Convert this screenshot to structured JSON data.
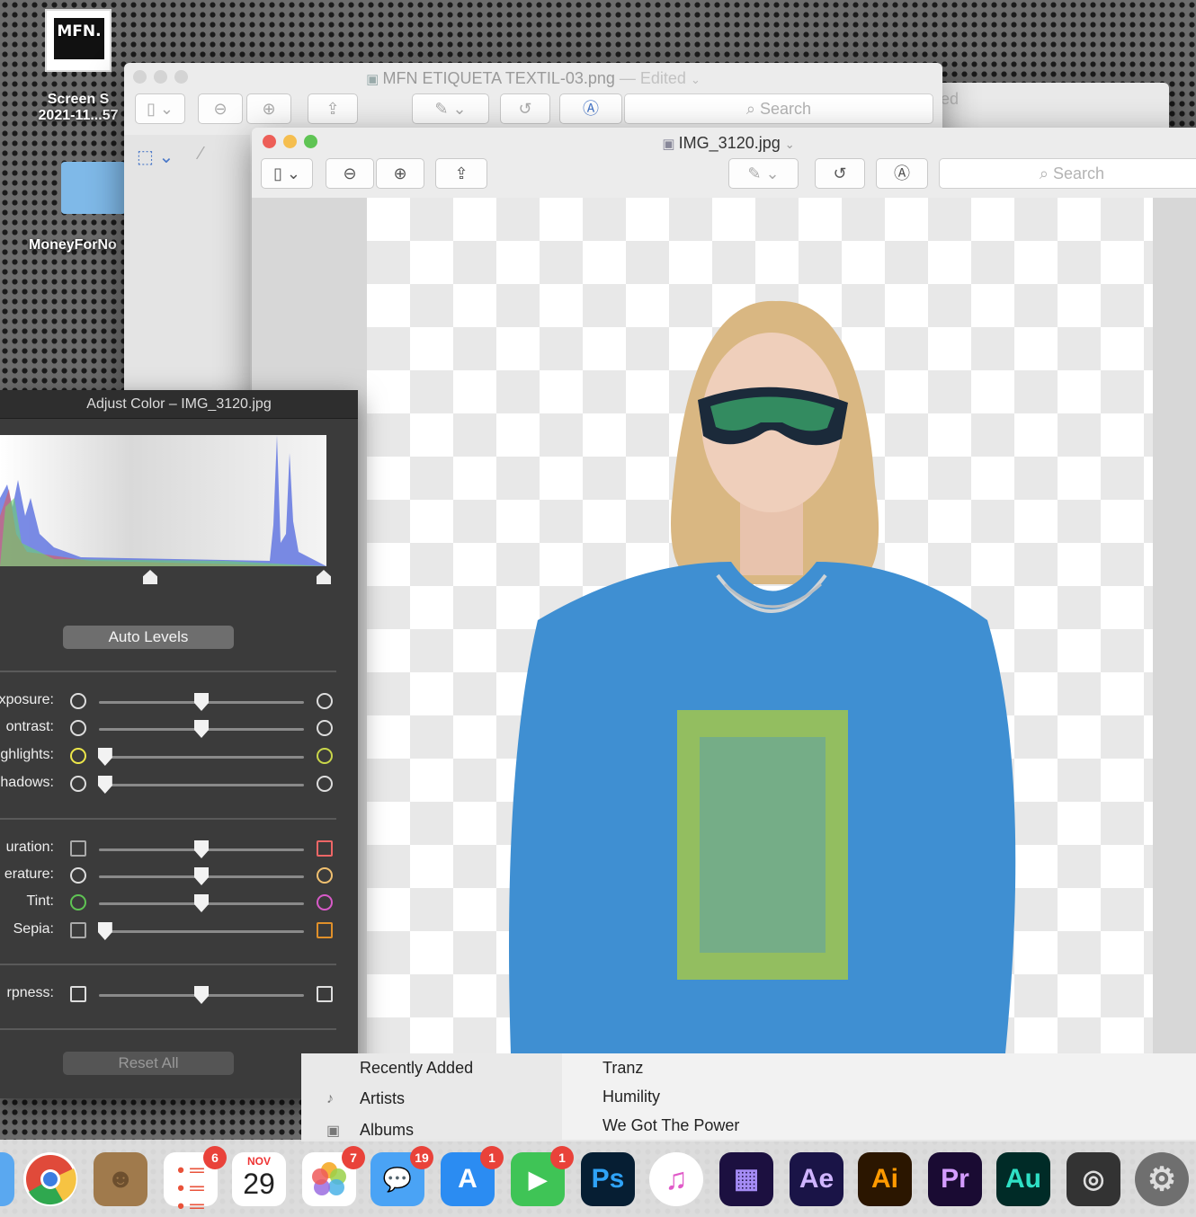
{
  "desktop": {
    "icon1_label": "Screen Sh\n2021-11...57",
    "icon1_label_a": "Screen S",
    "icon1_label_b": "2021-11...57",
    "thumb_text": "MFN.",
    "folder_label": "MoneyForNo"
  },
  "back_window": {
    "title": "MFN ETIQUETA TEXTIL-03.png",
    "edited": "— Edited",
    "search_placeholder": "Search",
    "side_title": "ed"
  },
  "front_window": {
    "title": "IMG_3120.jpg",
    "search_placeholder": "Search"
  },
  "adjust_panel": {
    "title": "Adjust Color – IMG_3120.jpg",
    "auto_levels": "Auto Levels",
    "reset_all": "Reset All",
    "rows": [
      {
        "label": "xposure:",
        "value": 0.5
      },
      {
        "label": "ontrast:",
        "value": 0.5
      },
      {
        "label": "ghlights:",
        "value": 0.03
      },
      {
        "label": "hadows:",
        "value": 0.03
      },
      {
        "label": "uration:",
        "value": 0.5
      },
      {
        "label": "erature:",
        "value": 0.5
      },
      {
        "label": "Tint:",
        "value": 0.5
      },
      {
        "label": "Sepia:",
        "value": 0.03
      },
      {
        "label": "rpness:",
        "value": 0.5
      }
    ]
  },
  "music": {
    "sidebar": [
      "Recently Added",
      "Artists",
      "Albums"
    ],
    "songs": [
      "Tranz",
      "Humility",
      "We Got The Power"
    ]
  },
  "dock": {
    "calendar_month": "NOV",
    "calendar_day": "29",
    "badges": {
      "reminders": "6",
      "photos": "7",
      "messages": "19",
      "appstore": "1",
      "facetime": "1"
    },
    "apps": {
      "ps": "Ps",
      "ae": "Ae",
      "ai": "Ai",
      "pr": "Pr",
      "au": "Au"
    }
  }
}
